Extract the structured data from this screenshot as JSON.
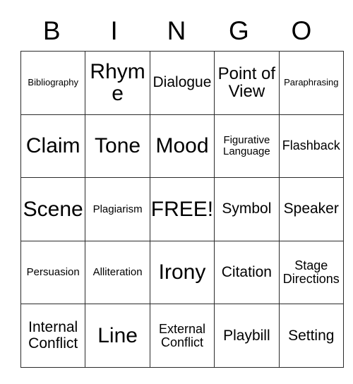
{
  "card": {
    "title": "BINGO",
    "header_letters": [
      "B",
      "I",
      "N",
      "G",
      "O"
    ],
    "columns": 5,
    "rows": 5,
    "free_space_label": "FREE!",
    "free_space_position": {
      "row": 3,
      "column": 3
    },
    "border_color": "#2b2b2b",
    "background_color": "#ffffff",
    "text_color": "#000000",
    "grid": [
      [
        {
          "label": "Bibliography",
          "size": "xs"
        },
        {
          "label": "Rhyme",
          "size": "xxl"
        },
        {
          "label": "Dialogue",
          "size": "l"
        },
        {
          "label": "Point of View",
          "size": "xl"
        },
        {
          "label": "Paraphrasing",
          "size": "xs"
        }
      ],
      [
        {
          "label": "Claim",
          "size": "xxl"
        },
        {
          "label": "Tone",
          "size": "xxl"
        },
        {
          "label": "Mood",
          "size": "xxl"
        },
        {
          "label": "Figurative Language",
          "size": "s"
        },
        {
          "label": "Flashback",
          "size": "m"
        }
      ],
      [
        {
          "label": "Scene",
          "size": "xxl"
        },
        {
          "label": "Plagiarism",
          "size": "s"
        },
        {
          "label": "FREE!",
          "size": "xxl"
        },
        {
          "label": "Symbol",
          "size": "l"
        },
        {
          "label": "Speaker",
          "size": "l"
        }
      ],
      [
        {
          "label": "Persuasion",
          "size": "s"
        },
        {
          "label": "Alliteration",
          "size": "s"
        },
        {
          "label": "Irony",
          "size": "xxl"
        },
        {
          "label": "Citation",
          "size": "l"
        },
        {
          "label": "Stage Directions",
          "size": "m"
        }
      ],
      [
        {
          "label": "Internal Conflict",
          "size": "l"
        },
        {
          "label": "Line",
          "size": "xxl"
        },
        {
          "label": "External Conflict",
          "size": "m"
        },
        {
          "label": "Playbill",
          "size": "l"
        },
        {
          "label": "Setting",
          "size": "l"
        }
      ]
    ]
  }
}
